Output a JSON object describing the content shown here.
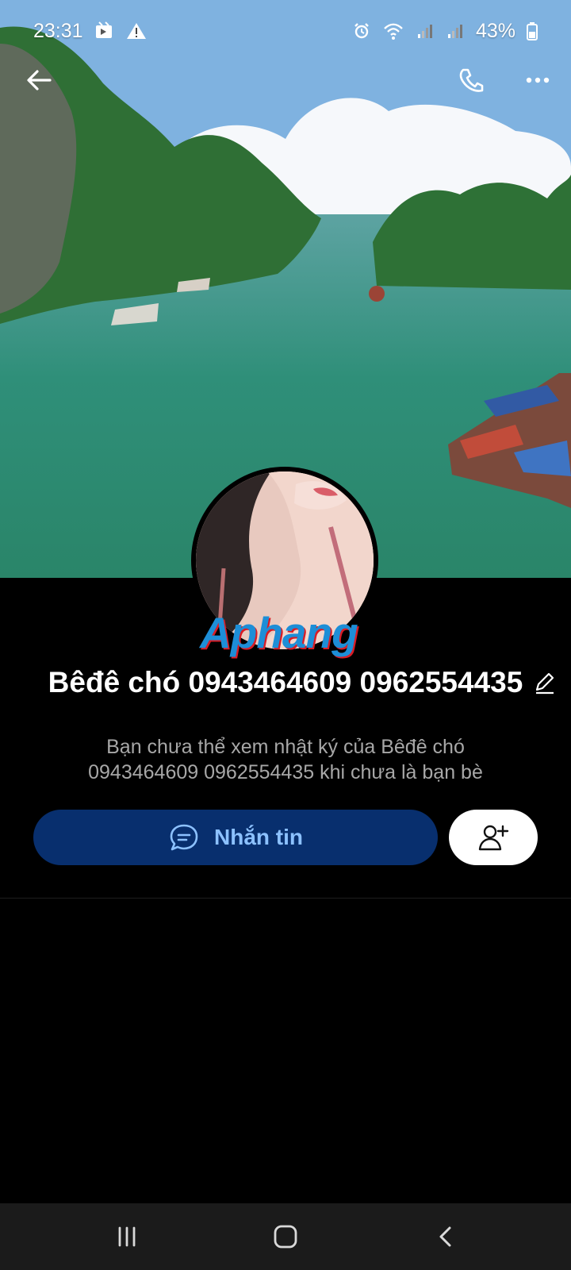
{
  "status_bar": {
    "time": "23:31",
    "battery": "43%",
    "left_icons": [
      "media-icon",
      "warning-icon"
    ],
    "right_icons": [
      "alarm-icon",
      "wifi-icon",
      "signal-icon",
      "signal-icon",
      "battery-icon"
    ]
  },
  "topbar": {
    "icons": [
      "back-arrow-icon",
      "phone-icon",
      "more-options-icon"
    ]
  },
  "profile": {
    "watermark": "Aphang",
    "name": "Bêđê chó 0943464609 0962554435",
    "privacy_message": "Bạn chưa thể xem nhật ký của Bêđê chó 0943464609 0962554435 khi chưa là bạn bè"
  },
  "actions": {
    "message_label": "Nhắn tin",
    "message_icon": "chat-bubble-icon",
    "add_friend_icon": "add-friend-icon"
  },
  "navigation": {
    "icons": [
      "recent-apps-icon",
      "home-icon",
      "back-icon"
    ]
  },
  "colors": {
    "background": "#000000",
    "message_button": "#082f6e",
    "message_text": "#8cc1ff",
    "privacy_text": "#a7a7a7"
  }
}
